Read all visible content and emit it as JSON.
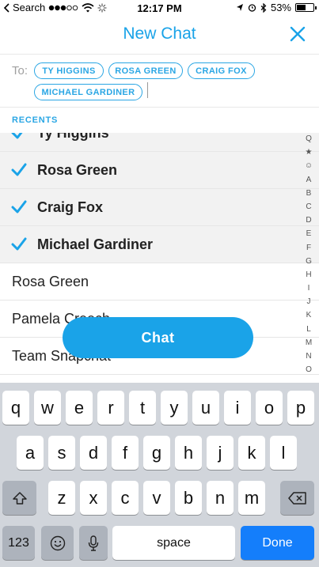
{
  "status_bar": {
    "back_app": "Search",
    "time": "12:17 PM",
    "battery_text": "53%",
    "battery_level": 0.53
  },
  "header": {
    "title": "New Chat"
  },
  "to": {
    "label": "To:",
    "recipients": [
      "TY HIGGINS",
      "ROSA GREEN",
      "CRAIG FOX",
      "MICHAEL GARDINER"
    ]
  },
  "recents": {
    "label": "RECENTS",
    "selected": [
      "Ty Higgins",
      "Rosa Green",
      "Craig Fox",
      "Michael Gardiner"
    ],
    "others": [
      "Rosa Green",
      "Pamela Creech",
      "Team Snapchat"
    ]
  },
  "index": [
    "Q",
    "★",
    "☺",
    "A",
    "B",
    "C",
    "D",
    "E",
    "F",
    "G",
    "H",
    "I",
    "J",
    "K",
    "L",
    "M",
    "N",
    "O"
  ],
  "chat_button": "Chat",
  "keyboard": {
    "row1": [
      "q",
      "w",
      "e",
      "r",
      "t",
      "y",
      "u",
      "i",
      "o",
      "p"
    ],
    "row2": [
      "a",
      "s",
      "d",
      "f",
      "g",
      "h",
      "j",
      "k",
      "l"
    ],
    "row3": [
      "z",
      "x",
      "c",
      "v",
      "b",
      "n",
      "m"
    ],
    "numbers_key": "123",
    "space_key": "space",
    "done_key": "Done"
  },
  "colors": {
    "accent": "#1aa3e8",
    "keyboard_bg": "#d1d5db",
    "done_key": "#147efb"
  }
}
